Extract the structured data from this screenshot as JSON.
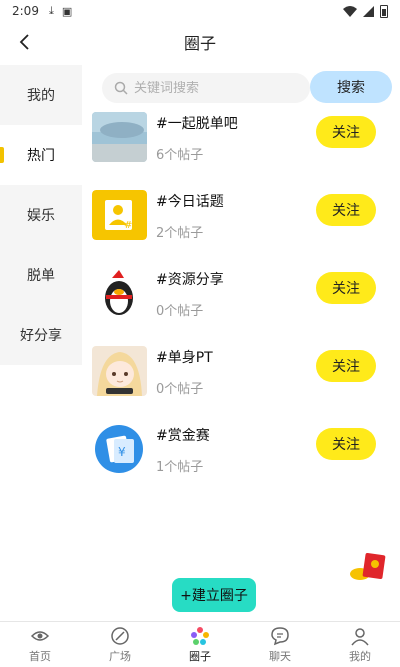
{
  "status": {
    "time": "2:09",
    "download_glyph": "⤓",
    "notif_glyph": "▣"
  },
  "header": {
    "title": "圈子"
  },
  "sidebar": {
    "items": [
      {
        "label": "我的"
      },
      {
        "label": "热门"
      },
      {
        "label": "娱乐"
      },
      {
        "label": "脱单"
      },
      {
        "label": "好分享"
      }
    ],
    "active_index": 1
  },
  "search": {
    "placeholder": "关键词搜索",
    "button_label": "搜索"
  },
  "circles": [
    {
      "title": "#一起脱单吧",
      "count": "6个帖子",
      "follow": "关注",
      "icon": "sea-photo-thumbnail"
    },
    {
      "title": "#今日话题",
      "count": "2个帖子",
      "follow": "关注",
      "icon": "topic-user-icon"
    },
    {
      "title": "#资源分享",
      "count": "0个帖子",
      "follow": "关注",
      "icon": "penguin-mascot-icon"
    },
    {
      "title": "#单身PT",
      "count": "0个帖子",
      "follow": "关注",
      "icon": "anime-girl-thumbnail"
    },
    {
      "title": "#赏金赛",
      "count": "1个帖子",
      "follow": "关注",
      "icon": "bounty-money-icon"
    }
  ],
  "create_button": {
    "label": "+建立圈子"
  },
  "tabbar": {
    "items": [
      {
        "label": "首页",
        "icon": "home-icon"
      },
      {
        "label": "广场",
        "icon": "square-icon"
      },
      {
        "label": "圈子",
        "icon": "circle-icon"
      },
      {
        "label": "聊天",
        "icon": "chat-icon"
      },
      {
        "label": "我的",
        "icon": "profile-icon"
      }
    ],
    "active_index": 2
  },
  "colors": {
    "follow_button": "#ffea1a",
    "search_button": "#bfe3ff",
    "create_button": "#27dcc4",
    "sidebar_indicator": "#f2c200"
  }
}
